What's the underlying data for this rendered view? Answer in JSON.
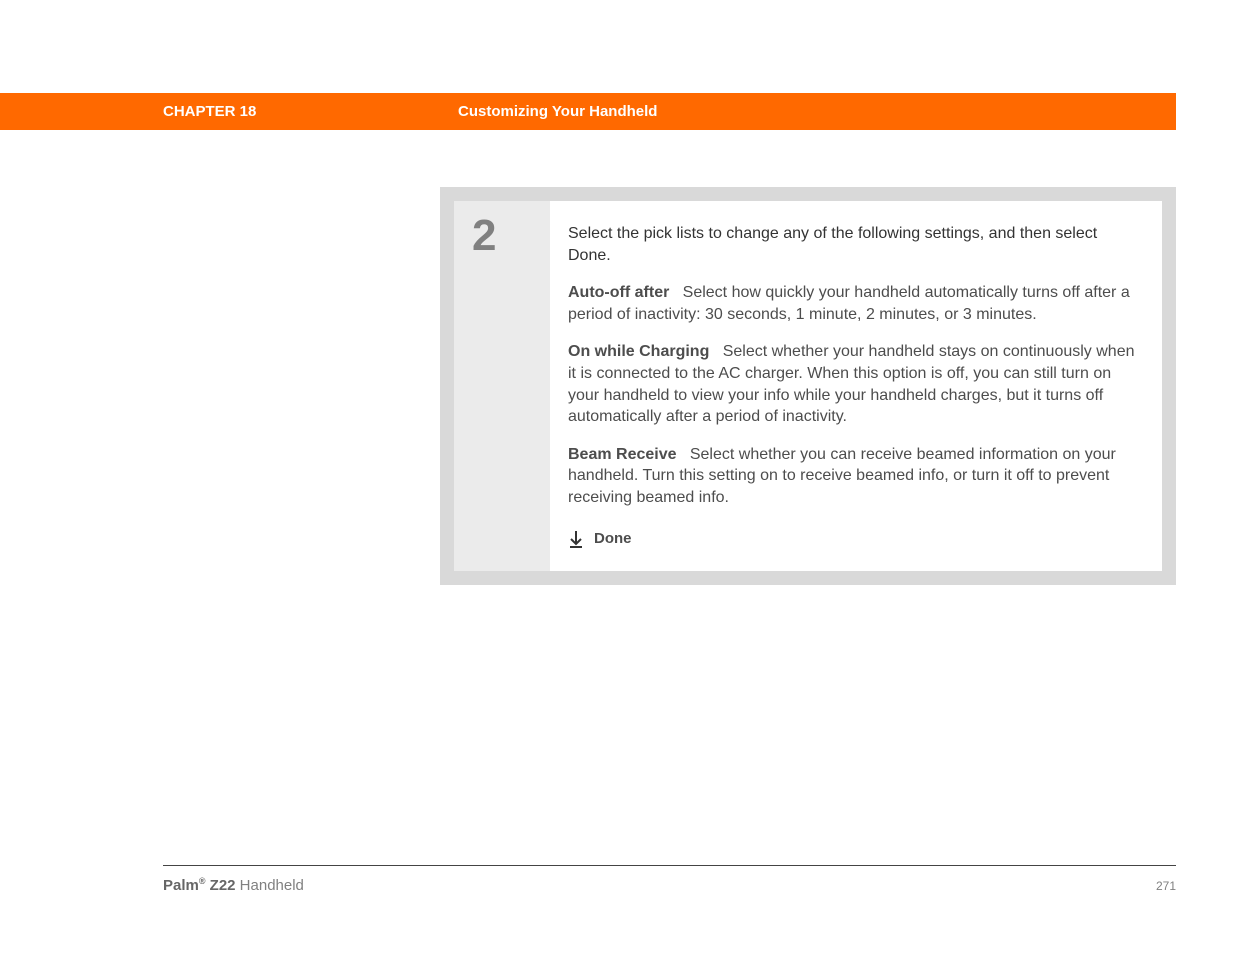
{
  "header": {
    "chapter_label": "CHAPTER 18",
    "chapter_title": "Customizing Your Handheld"
  },
  "step": {
    "number": "2",
    "intro": "Select the pick lists to change any of the following settings, and then select Done.",
    "settings": [
      {
        "label": "Auto-off after",
        "description": "Select how quickly your handheld automatically turns off after a period of inactivity: 30 seconds, 1 minute, 2 minutes, or 3 minutes."
      },
      {
        "label": "On while Charging",
        "description": "Select whether your handheld stays on continuously when it is connected to the AC charger. When this option is off, you can still turn on your handheld to view your info while your handheld charges, but it turns off automatically after a period of inactivity."
      },
      {
        "label": "Beam Receive",
        "description": "Select whether you can receive beamed information on your handheld. Turn this setting on to receive beamed info, or turn it off to prevent receiving beamed info."
      }
    ],
    "done_label": "Done"
  },
  "footer": {
    "brand": "Palm",
    "reg": "®",
    "model": " Z22",
    "product_suffix": " Handheld",
    "page_number": "271"
  }
}
